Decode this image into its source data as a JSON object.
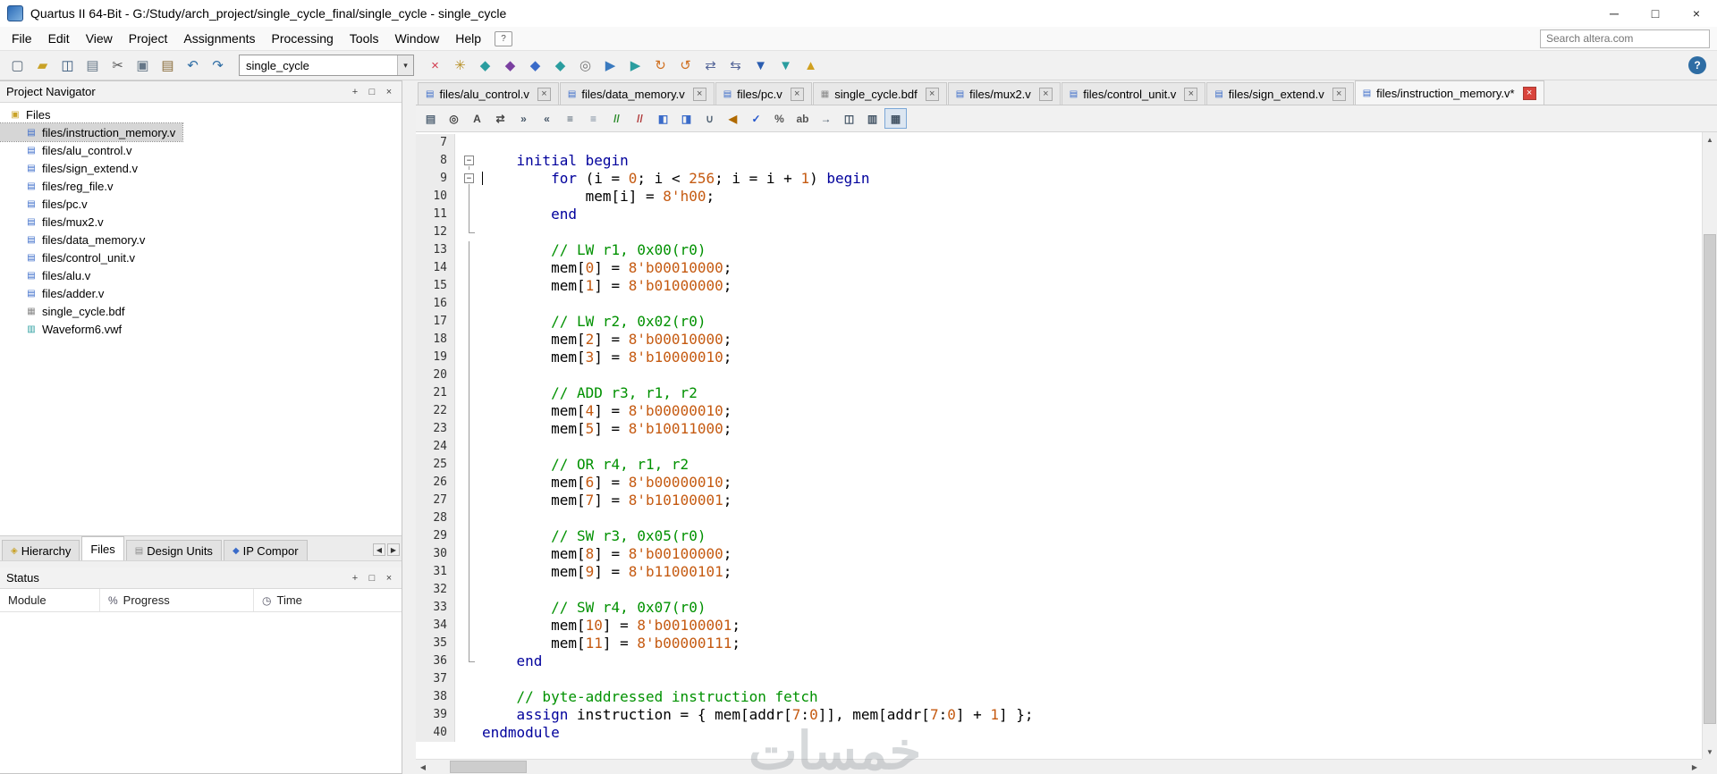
{
  "colors": {
    "keyword": "#00009C",
    "number": "#C55A11",
    "comment": "#009100",
    "plain": "#000000",
    "selection_bg": "#D6D6D6",
    "active_close": "#D9443C"
  },
  "glyphs": {
    "close": "×",
    "minus": "−",
    "dropdown": "▾",
    "up": "▲",
    "down": "▼",
    "left": "◀",
    "right": "▶",
    "pin": "+",
    "float": "□",
    "help": "?"
  },
  "window": {
    "title": "Quartus II 64-Bit - G:/Study/arch_project/single_cycle_final/single_cycle - single_cycle",
    "controls": {
      "minimize": "─",
      "maximize": "□",
      "close": "×"
    }
  },
  "menu_bar": {
    "items": [
      "File",
      "Edit",
      "View",
      "Project",
      "Assignments",
      "Processing",
      "Tools",
      "Window",
      "Help"
    ],
    "search_placeholder": "Search altera.com"
  },
  "toolbar": {
    "project_dropdown_value": "single_cycle",
    "icons_left": [
      {
        "name": "new-file-icon",
        "glyph": "▢",
        "color": "#556677"
      },
      {
        "name": "open-file-icon",
        "glyph": "▰",
        "color": "#C9A227"
      },
      {
        "name": "save-icon",
        "glyph": "◫",
        "color": "#34567A"
      },
      {
        "name": "print-icon",
        "glyph": "▤",
        "color": "#667788"
      },
      {
        "name": "cut-icon",
        "glyph": "✂",
        "color": "#555555"
      },
      {
        "name": "copy-icon",
        "glyph": "▣",
        "color": "#667788"
      },
      {
        "name": "paste-icon",
        "glyph": "▤",
        "color": "#8A6D3B"
      },
      {
        "name": "undo-icon",
        "glyph": "↶",
        "color": "#2E6DA4"
      },
      {
        "name": "redo-icon",
        "glyph": "↷",
        "color": "#2E6DA4"
      }
    ],
    "icons_right": [
      {
        "name": "stop-processing-icon",
        "glyph": "×",
        "color": "#D23B4E"
      },
      {
        "name": "assignment-editor-icon",
        "glyph": "✳",
        "color": "#B8912A"
      },
      {
        "name": "analysis-synthesis-icon",
        "glyph": "◆",
        "color": "#2A9D9F"
      },
      {
        "name": "fitter-icon",
        "glyph": "◆",
        "color": "#7A3FA0"
      },
      {
        "name": "assembler-icon",
        "glyph": "◆",
        "color": "#3A6BC9"
      },
      {
        "name": "timequest-icon",
        "glyph": "◆",
        "color": "#2A9D9F"
      },
      {
        "name": "compilation-report-icon",
        "glyph": "◎",
        "color": "#777777"
      },
      {
        "name": "start-compilation-icon",
        "glyph": "▶",
        "color": "#3A7ABF"
      },
      {
        "name": "start-analysis-icon",
        "glyph": "▶",
        "color": "#2A9D9F"
      },
      {
        "name": "rapid-recompile-icon",
        "glyph": "↻",
        "color": "#D07020"
      },
      {
        "name": "powerplay-analyzer-icon",
        "glyph": "↺",
        "color": "#D07020"
      },
      {
        "name": "rtl-viewer-icon",
        "glyph": "⇄",
        "color": "#556699"
      },
      {
        "name": "technology-map-viewer-icon",
        "glyph": "⇆",
        "color": "#556699"
      },
      {
        "name": "programmer-icon",
        "glyph": "▼",
        "color": "#2A5DB0"
      },
      {
        "name": "signaltap-icon",
        "glyph": "▼",
        "color": "#2A9D9F"
      },
      {
        "name": "ip-catalog-icon",
        "glyph": "▲",
        "color": "#D0A020"
      }
    ]
  },
  "icon_defs": {
    "folder": {
      "name": "folder-icon",
      "glyph": "▣",
      "color": "#C9A227"
    },
    "verilog": {
      "name": "verilog-file-icon",
      "glyph": "▤",
      "color": "#3A6BC9"
    },
    "bdf": {
      "name": "bdf-file-icon",
      "glyph": "▦",
      "color": "#888888"
    },
    "vwf": {
      "name": "waveform-file-icon",
      "glyph": "▥",
      "color": "#2A9D9F"
    }
  },
  "project_navigator": {
    "title": "Project Navigator",
    "root": {
      "label": "Files",
      "type": "folder"
    },
    "files": [
      {
        "label": "files/instruction_memory.v",
        "type": "verilog",
        "selected": true
      },
      {
        "label": "files/alu_control.v",
        "type": "verilog"
      },
      {
        "label": "files/sign_extend.v",
        "type": "verilog"
      },
      {
        "label": "files/reg_file.v",
        "type": "verilog"
      },
      {
        "label": "files/pc.v",
        "type": "verilog"
      },
      {
        "label": "files/mux2.v",
        "type": "verilog"
      },
      {
        "label": "files/data_memory.v",
        "type": "verilog"
      },
      {
        "label": "files/control_unit.v",
        "type": "verilog"
      },
      {
        "label": "files/alu.v",
        "type": "verilog"
      },
      {
        "label": "files/adder.v",
        "type": "verilog"
      },
      {
        "label": "single_cycle.bdf",
        "type": "bdf"
      },
      {
        "label": "Waveform6.vwf",
        "type": "vwf"
      }
    ],
    "tabs": [
      {
        "label": "Hierarchy",
        "icon": {
          "name": "hierarchy-icon",
          "glyph": "◈",
          "color": "#C9A227"
        }
      },
      {
        "label": "Files",
        "active": true
      },
      {
        "label": "Design Units",
        "icon": {
          "name": "design-units-icon",
          "glyph": "▤",
          "color": "#8A8A8A"
        }
      },
      {
        "label": "IP Compor",
        "icon": {
          "name": "ip-components-icon",
          "glyph": "◆",
          "color": "#3A6BC9"
        }
      }
    ]
  },
  "status_panel": {
    "title": "Status",
    "columns": [
      {
        "icon": "",
        "label": "Module"
      },
      {
        "icon": "%",
        "label": "Progress"
      },
      {
        "icon": "◷",
        "label": "Time"
      }
    ]
  },
  "editor": {
    "tabs": [
      {
        "label": "files/alu_control.v",
        "type": "verilog"
      },
      {
        "label": "files/data_memory.v",
        "type": "verilog"
      },
      {
        "label": "files/pc.v",
        "type": "verilog"
      },
      {
        "label": "single_cycle.bdf",
        "type": "bdf"
      },
      {
        "label": "files/mux2.v",
        "type": "verilog"
      },
      {
        "label": "files/control_unit.v",
        "type": "verilog"
      },
      {
        "label": "files/sign_extend.v",
        "type": "verilog"
      },
      {
        "label": "files/instruction_memory.v*",
        "type": "verilog",
        "active": true
      }
    ],
    "toolbar_icons": [
      {
        "name": "print-icon",
        "glyph": "▤",
        "color": "#556677"
      },
      {
        "name": "find-icon",
        "glyph": "◎",
        "color": "#444444"
      },
      {
        "name": "incremental-find-icon",
        "glyph": "A",
        "color": "#444444"
      },
      {
        "name": "find-replace-icon",
        "glyph": "⇄",
        "color": "#444444"
      },
      {
        "name": "indent-increase-icon",
        "glyph": "»",
        "color": "#445566"
      },
      {
        "name": "indent-decrease-icon",
        "glyph": "«",
        "color": "#445566"
      },
      {
        "name": "align-left-icon",
        "glyph": "≡",
        "color": "#445566"
      },
      {
        "name": "align-right-icon",
        "glyph": "≡",
        "color": "#778899"
      },
      {
        "name": "comment-icon",
        "glyph": "//",
        "color": "#2A8A2A"
      },
      {
        "name": "uncomment-icon",
        "glyph": "//",
        "color": "#B03A3A"
      },
      {
        "name": "add-bookmark-icon",
        "glyph": "◧",
        "color": "#3A6BC9"
      },
      {
        "name": "next-bookmark-icon",
        "glyph": "◨",
        "color": "#3A6BC9"
      },
      {
        "name": "attach-icon",
        "glyph": "∪",
        "color": "#556677"
      },
      {
        "name": "megaphone-icon",
        "glyph": "◀",
        "color": "#B06A00"
      },
      {
        "name": "syntax-check-icon",
        "glyph": "✓",
        "color": "#2255CC"
      },
      {
        "name": "word-stats-icon",
        "glyph": "%",
        "color": "#555555"
      },
      {
        "name": "word-wrap-icon",
        "glyph": "ab",
        "color": "#555555"
      },
      {
        "name": "goto-line-icon",
        "glyph": "→",
        "color": "#445566"
      },
      {
        "name": "split-window-icon",
        "glyph": "◫",
        "color": "#445566"
      },
      {
        "name": "documentation-icon",
        "glyph": "▥",
        "color": "#445566"
      },
      {
        "name": "current-file-icon",
        "glyph": "▦",
        "color": "#445566",
        "pressed": true
      }
    ],
    "lines": [
      {
        "no": 7,
        "f": "",
        "t": []
      },
      {
        "no": 8,
        "f": "b",
        "t": [
          [
            "p",
            "    "
          ],
          [
            "k",
            "initial"
          ],
          [
            "p",
            " "
          ],
          [
            "k",
            "begin"
          ]
        ]
      },
      {
        "no": 9,
        "f": "b",
        "caret": true,
        "t": [
          [
            "p",
            "        "
          ],
          [
            "k",
            "for"
          ],
          [
            "p",
            " (i = "
          ],
          [
            "n",
            "0"
          ],
          [
            "p",
            "; i < "
          ],
          [
            "n",
            "256"
          ],
          [
            "p",
            "; i = i + "
          ],
          [
            "n",
            "1"
          ],
          [
            "p",
            ") "
          ],
          [
            "k",
            "begin"
          ]
        ]
      },
      {
        "no": 10,
        "f": "l",
        "t": [
          [
            "p",
            "            mem[i] = "
          ],
          [
            "n",
            "8'h00"
          ],
          [
            "p",
            ";"
          ]
        ]
      },
      {
        "no": 11,
        "f": "l",
        "t": [
          [
            "p",
            "        "
          ],
          [
            "k",
            "end"
          ]
        ]
      },
      {
        "no": 12,
        "f": "e",
        "t": []
      },
      {
        "no": 13,
        "f": "l",
        "t": [
          [
            "p",
            "        "
          ],
          [
            "c",
            "// LW r1, 0x00(r0)"
          ]
        ]
      },
      {
        "no": 14,
        "f": "l",
        "t": [
          [
            "p",
            "        mem["
          ],
          [
            "n",
            "0"
          ],
          [
            "p",
            "] = "
          ],
          [
            "n",
            "8'b00010000"
          ],
          [
            "p",
            ";"
          ]
        ]
      },
      {
        "no": 15,
        "f": "l",
        "t": [
          [
            "p",
            "        mem["
          ],
          [
            "n",
            "1"
          ],
          [
            "p",
            "] = "
          ],
          [
            "n",
            "8'b01000000"
          ],
          [
            "p",
            ";"
          ]
        ]
      },
      {
        "no": 16,
        "f": "l",
        "t": []
      },
      {
        "no": 17,
        "f": "l",
        "t": [
          [
            "p",
            "        "
          ],
          [
            "c",
            "// LW r2, 0x02(r0)"
          ]
        ]
      },
      {
        "no": 18,
        "f": "l",
        "t": [
          [
            "p",
            "        mem["
          ],
          [
            "n",
            "2"
          ],
          [
            "p",
            "] = "
          ],
          [
            "n",
            "8'b00010000"
          ],
          [
            "p",
            ";"
          ]
        ]
      },
      {
        "no": 19,
        "f": "l",
        "t": [
          [
            "p",
            "        mem["
          ],
          [
            "n",
            "3"
          ],
          [
            "p",
            "] = "
          ],
          [
            "n",
            "8'b10000010"
          ],
          [
            "p",
            ";"
          ]
        ]
      },
      {
        "no": 20,
        "f": "l",
        "t": []
      },
      {
        "no": 21,
        "f": "l",
        "t": [
          [
            "p",
            "        "
          ],
          [
            "c",
            "// ADD r3, r1, r2"
          ]
        ]
      },
      {
        "no": 22,
        "f": "l",
        "t": [
          [
            "p",
            "        mem["
          ],
          [
            "n",
            "4"
          ],
          [
            "p",
            "] = "
          ],
          [
            "n",
            "8'b00000010"
          ],
          [
            "p",
            ";"
          ]
        ]
      },
      {
        "no": 23,
        "f": "l",
        "t": [
          [
            "p",
            "        mem["
          ],
          [
            "n",
            "5"
          ],
          [
            "p",
            "] = "
          ],
          [
            "n",
            "8'b10011000"
          ],
          [
            "p",
            ";"
          ]
        ]
      },
      {
        "no": 24,
        "f": "l",
        "t": []
      },
      {
        "no": 25,
        "f": "l",
        "t": [
          [
            "p",
            "        "
          ],
          [
            "c",
            "// OR r4, r1, r2"
          ]
        ]
      },
      {
        "no": 26,
        "f": "l",
        "t": [
          [
            "p",
            "        mem["
          ],
          [
            "n",
            "6"
          ],
          [
            "p",
            "] = "
          ],
          [
            "n",
            "8'b00000010"
          ],
          [
            "p",
            ";"
          ]
        ]
      },
      {
        "no": 27,
        "f": "l",
        "t": [
          [
            "p",
            "        mem["
          ],
          [
            "n",
            "7"
          ],
          [
            "p",
            "] = "
          ],
          [
            "n",
            "8'b10100001"
          ],
          [
            "p",
            ";"
          ]
        ]
      },
      {
        "no": 28,
        "f": "l",
        "t": []
      },
      {
        "no": 29,
        "f": "l",
        "t": [
          [
            "p",
            "        "
          ],
          [
            "c",
            "// SW r3, 0x05(r0)"
          ]
        ]
      },
      {
        "no": 30,
        "f": "l",
        "t": [
          [
            "p",
            "        mem["
          ],
          [
            "n",
            "8"
          ],
          [
            "p",
            "] = "
          ],
          [
            "n",
            "8'b00100000"
          ],
          [
            "p",
            ";"
          ]
        ]
      },
      {
        "no": 31,
        "f": "l",
        "t": [
          [
            "p",
            "        mem["
          ],
          [
            "n",
            "9"
          ],
          [
            "p",
            "] = "
          ],
          [
            "n",
            "8'b11000101"
          ],
          [
            "p",
            ";"
          ]
        ]
      },
      {
        "no": 32,
        "f": "l",
        "t": []
      },
      {
        "no": 33,
        "f": "l",
        "t": [
          [
            "p",
            "        "
          ],
          [
            "c",
            "// SW r4, 0x07(r0)"
          ]
        ]
      },
      {
        "no": 34,
        "f": "l",
        "t": [
          [
            "p",
            "        mem["
          ],
          [
            "n",
            "10"
          ],
          [
            "p",
            "] = "
          ],
          [
            "n",
            "8'b00100001"
          ],
          [
            "p",
            ";"
          ]
        ]
      },
      {
        "no": 35,
        "f": "l",
        "t": [
          [
            "p",
            "        mem["
          ],
          [
            "n",
            "11"
          ],
          [
            "p",
            "] = "
          ],
          [
            "n",
            "8'b00000111"
          ],
          [
            "p",
            ";"
          ]
        ]
      },
      {
        "no": 36,
        "f": "e",
        "t": [
          [
            "p",
            "    "
          ],
          [
            "k",
            "end"
          ]
        ]
      },
      {
        "no": 37,
        "f": "",
        "t": []
      },
      {
        "no": 38,
        "f": "",
        "t": [
          [
            "p",
            "    "
          ],
          [
            "c",
            "// byte-addressed instruction fetch"
          ]
        ]
      },
      {
        "no": 39,
        "f": "",
        "t": [
          [
            "p",
            "    "
          ],
          [
            "k",
            "assign"
          ],
          [
            "p",
            " instruction = { mem[addr["
          ],
          [
            "n",
            "7"
          ],
          [
            "p",
            ":"
          ],
          [
            "n",
            "0"
          ],
          [
            "p",
            "]], mem[addr["
          ],
          [
            "n",
            "7"
          ],
          [
            "p",
            ":"
          ],
          [
            "n",
            "0"
          ],
          [
            "p",
            "] + "
          ],
          [
            "n",
            "1"
          ],
          [
            "p",
            "] };"
          ]
        ]
      },
      {
        "no": 40,
        "f": "",
        "t": [
          [
            "k",
            "endmodule"
          ]
        ]
      }
    ]
  },
  "watermark": {
    "text": "خمسات"
  }
}
